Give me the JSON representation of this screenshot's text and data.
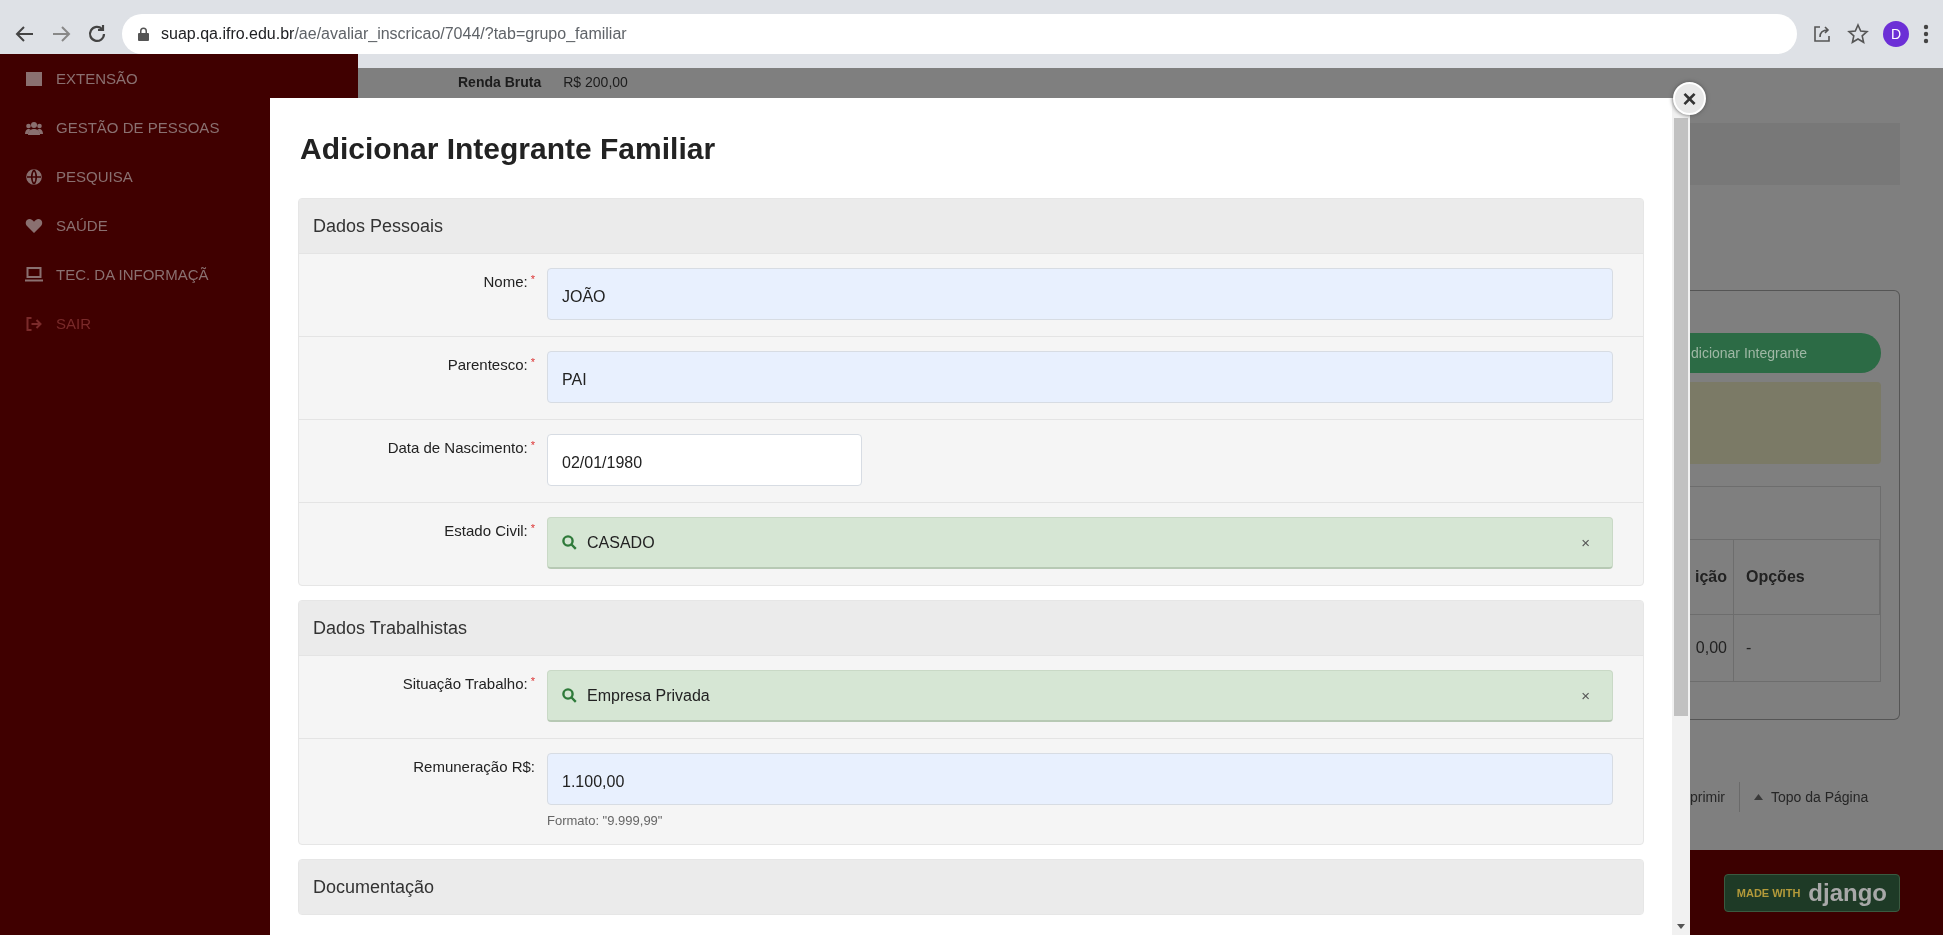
{
  "browser": {
    "url_host": "suap.qa.ifro.edu.br",
    "url_path": "/ae/avaliar_inscricao/7044/?tab=grupo_familiar",
    "profile_initial": "D"
  },
  "sidebar": {
    "items": [
      {
        "label": "EXTENSÃO",
        "kind": "menu"
      },
      {
        "label": "GESTÃO DE PESSOAS",
        "kind": "menu"
      },
      {
        "label": "PESQUISA",
        "kind": "menu"
      },
      {
        "label": "SAÚDE",
        "kind": "menu"
      },
      {
        "label": "TEC. DA INFORMAÇÃ",
        "kind": "menu"
      },
      {
        "label": "SAIR",
        "kind": "logout"
      }
    ]
  },
  "page": {
    "summary_label": "Renda Bruta",
    "summary_value": "R$ 200,00",
    "add_button": "dicionar Integrante",
    "table": {
      "columns": [
        "ição",
        "Opções"
      ],
      "rows": [
        [
          "0,00",
          "-"
        ]
      ]
    },
    "footer_links": [
      "primir",
      "Topo da Página"
    ],
    "badge": {
      "prefix": "MADE WITH",
      "logo": "django"
    }
  },
  "modal": {
    "title": "Adicionar Integrante Familiar",
    "close": "×",
    "sections": [
      {
        "title": "Dados Pessoais",
        "fields": [
          {
            "label": "Nome:",
            "required_mark": "*",
            "kind": "text",
            "value": "JOÃO"
          },
          {
            "label": "Parentesco:",
            "required_mark": "*",
            "kind": "text",
            "value": "PAI"
          },
          {
            "label": "Data de Nascimento:",
            "required_mark": "*",
            "kind": "date",
            "value": "02/01/1980"
          },
          {
            "label": "Estado Civil:",
            "required_mark": "*",
            "kind": "select",
            "value": "CASADO",
            "clear": "×"
          }
        ]
      },
      {
        "title": "Dados Trabalhistas",
        "fields": [
          {
            "label": "Situação Trabalho:",
            "required_mark": "*",
            "kind": "select",
            "value": "Empresa Privada",
            "clear": "×"
          },
          {
            "label": "Remuneração R$:",
            "kind": "text",
            "value": "1.100,00",
            "help": "Formato: \"9.999,99\""
          }
        ]
      },
      {
        "title": "Documentação"
      }
    ]
  }
}
